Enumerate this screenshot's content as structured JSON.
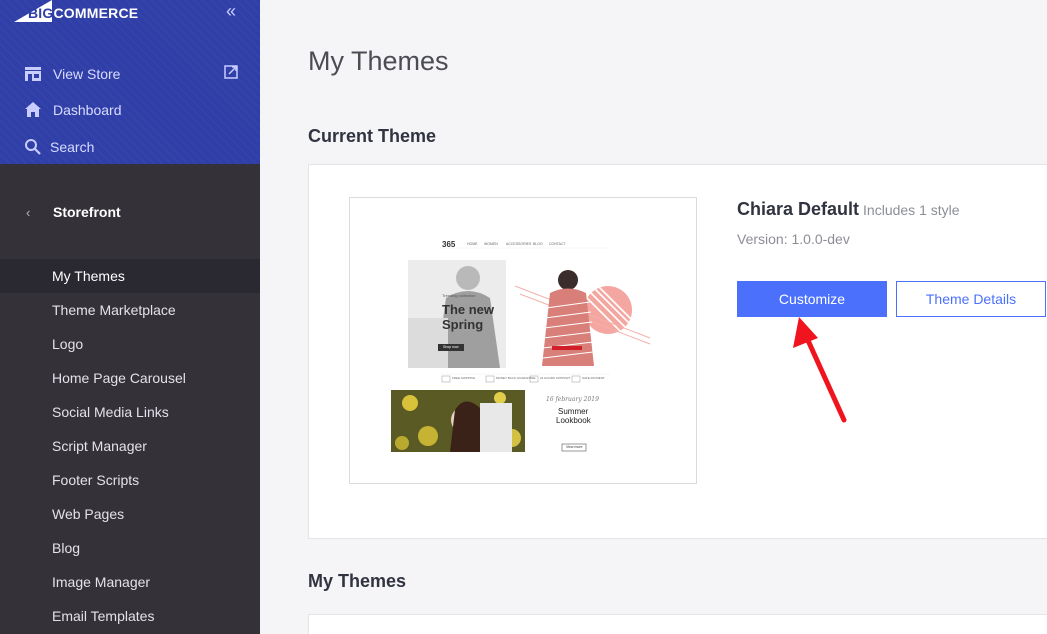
{
  "brand": {
    "logo_big": "BIG",
    "logo_rest": "COMMERCE"
  },
  "sidebar": {
    "collapse_label": "«",
    "top_items": [
      {
        "label": "View Store",
        "icon": "storefront-icon"
      },
      {
        "label": "Dashboard",
        "icon": "home-icon"
      },
      {
        "label": "Search",
        "icon": "search-icon"
      }
    ],
    "section": {
      "label": "Storefront",
      "back_icon": "chevron-left-icon"
    },
    "items": [
      {
        "label": "My Themes",
        "active": true
      },
      {
        "label": "Theme Marketplace"
      },
      {
        "label": "Logo"
      },
      {
        "label": "Home Page Carousel"
      },
      {
        "label": "Social Media Links"
      },
      {
        "label": "Script Manager"
      },
      {
        "label": "Footer Scripts"
      },
      {
        "label": "Web Pages"
      },
      {
        "label": "Blog"
      },
      {
        "label": "Image Manager"
      },
      {
        "label": "Email Templates"
      }
    ]
  },
  "main": {
    "page_title": "My Themes",
    "current_theme_heading": "Current Theme",
    "my_themes_heading": "My Themes",
    "theme": {
      "name": "Chiara Default",
      "styles": "Includes 1 style",
      "version": "Version: 1.0.0-dev",
      "customize_label": "Customize",
      "details_label": "Theme Details"
    },
    "preview": {
      "logo": "365",
      "nav": [
        "HOME",
        "WOMEN",
        "ACCESSORIES",
        "BLOG",
        "CONTACT"
      ],
      "headline_1": "The new",
      "headline_2": "Spring",
      "kicker": "Trending collection",
      "button": "Shop now",
      "features": [
        "FREE SHIPPING",
        "MONEY BACK GUARANTEE",
        "24 HOURS SUPPORT",
        "SAFE PAYMENT"
      ],
      "script": "16 february 2019",
      "lookbook_1": "Summer",
      "lookbook_2": "Lookbook",
      "lookbook_btn": "View more"
    }
  },
  "colors": {
    "sidebar_top": "#303fa8",
    "sidebar": "#343139",
    "accent": "#4b71fc",
    "arrow": "#f0141e"
  }
}
